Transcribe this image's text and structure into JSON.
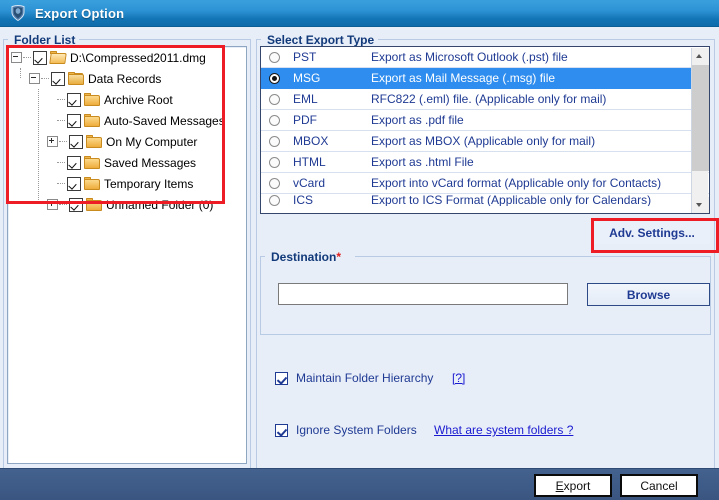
{
  "window": {
    "title": "Export Option",
    "icon": "app-shield-icon"
  },
  "folder_list": {
    "legend": "Folder List",
    "tree": [
      {
        "label": "D:\\Compressed2011.dmg",
        "depth": 0,
        "expander": "minus",
        "checked": true,
        "icon": "folder-open-icon"
      },
      {
        "label": "Data Records",
        "depth": 1,
        "expander": "minus",
        "checked": true,
        "icon": "folder-archive-icon"
      },
      {
        "label": "Archive Root",
        "depth": 2,
        "expander": "none",
        "checked": true,
        "icon": "folder-icon"
      },
      {
        "label": "Auto-Saved Messages",
        "depth": 2,
        "expander": "none",
        "checked": true,
        "icon": "folder-icon"
      },
      {
        "label": "On My Computer",
        "depth": 2,
        "expander": "plus",
        "checked": true,
        "icon": "folder-icon"
      },
      {
        "label": "Saved Messages",
        "depth": 2,
        "expander": "none",
        "checked": true,
        "icon": "folder-icon"
      },
      {
        "label": "Temporary Items",
        "depth": 2,
        "expander": "none",
        "checked": true,
        "icon": "folder-icon"
      },
      {
        "label": "Unnamed Folder (0)",
        "depth": 2,
        "expander": "plus",
        "checked": true,
        "icon": "folder-icon"
      }
    ]
  },
  "export_type": {
    "legend": "Select Export Type",
    "selected": "MSG",
    "options": [
      {
        "name": "PST",
        "description": "Export as Microsoft Outlook (.pst) file",
        "selected": false
      },
      {
        "name": "MSG",
        "description": "Export as Mail Message (.msg) file",
        "selected": true
      },
      {
        "name": "EML",
        "description": "RFC822 (.eml) file. (Applicable only for mail)",
        "selected": false
      },
      {
        "name": "PDF",
        "description": "Export as .pdf file",
        "selected": false
      },
      {
        "name": "MBOX",
        "description": "Export as MBOX (Applicable only for mail)",
        "selected": false
      },
      {
        "name": "HTML",
        "description": "Export as .html File",
        "selected": false
      },
      {
        "name": "vCard",
        "description": "Export into vCard format (Applicable only for Contacts)",
        "selected": false
      },
      {
        "name": "ICS",
        "description": "Export to ICS Format (Applicable only for Calendars)",
        "selected": false
      }
    ],
    "scrollbar": {
      "up_icon": "chevron-up-icon",
      "down_icon": "chevron-down-icon"
    }
  },
  "adv_settings": {
    "label": "Adv. Settings...",
    "highlight_color": "#ee1c25"
  },
  "destination": {
    "legend": "Destination",
    "required_marker": "*",
    "path_value": "",
    "path_placeholder": "",
    "browse_label": "Browse"
  },
  "options": {
    "maintain_hierarchy": {
      "label": "Maintain Folder Hierarchy",
      "checked": true,
      "help_link": "[?]"
    },
    "ignore_system_folders": {
      "label": "Ignore System Folders",
      "checked": true,
      "help_link": "What are system folders ?"
    }
  },
  "footer": {
    "export_accel": "E",
    "export_rest": "xport",
    "cancel_label": "Cancel"
  },
  "colors": {
    "title_bar": "#1173b4",
    "selection": "#2e8def",
    "accent_text": "#1f3a93",
    "highlight": "#ee1c25",
    "footer": "#3a5580"
  }
}
